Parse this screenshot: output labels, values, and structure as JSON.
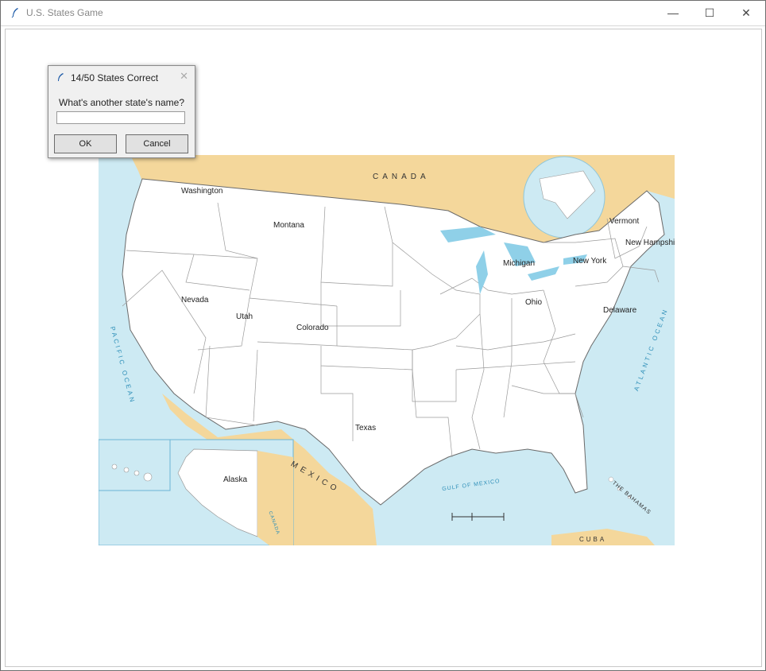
{
  "window": {
    "title": "U.S. States Game",
    "controls": {
      "minimize": "—",
      "maximize": "☐",
      "close": "✕"
    }
  },
  "dialog": {
    "title": "14/50 States Correct",
    "prompt": "What's another state's name?",
    "input_value": "",
    "ok_label": "OK",
    "cancel_label": "Cancel",
    "close_glyph": "✕"
  },
  "map": {
    "regions": {
      "canada": "CANADA",
      "mexico": "MEXICO",
      "canada_small": "CANADA"
    },
    "oceans": {
      "pacific": "PACIFIC OCEAN",
      "atlantic": "ATLANTIC OCEAN",
      "gulf": "GULF OF MEXICO",
      "bahamas": "THE BAHAMAS",
      "cuba": "CUBA"
    },
    "guessed_states": [
      "Washington",
      "Montana",
      "Nevada",
      "Utah",
      "Colorado",
      "Texas",
      "Alaska",
      "Michigan",
      "Ohio",
      "New York",
      "Vermont",
      "New Hampshire",
      "Delaware"
    ],
    "colors": {
      "water": "#cdeaf3",
      "land_foreign": "#f4d79b",
      "state_fill": "#ffffff",
      "border": "#9a9a9a"
    }
  }
}
